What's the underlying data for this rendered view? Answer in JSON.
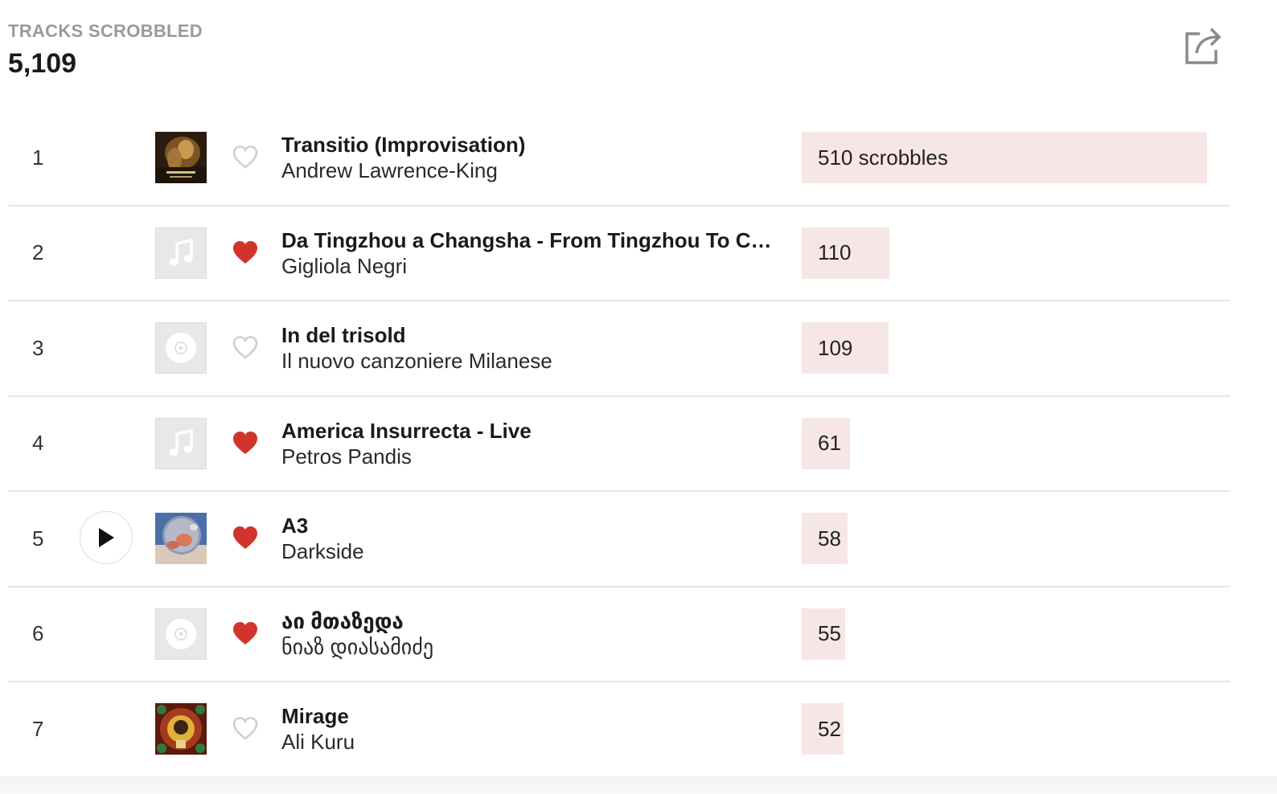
{
  "stats": {
    "label": "TRACKS SCROBBLED",
    "value": "5,109"
  },
  "share_icon": "share-icon",
  "colors": {
    "love_active": "#d0342c",
    "love_inactive": "#cfcfcf",
    "bar_fill": "#f7e6e6"
  },
  "tracks": [
    {
      "rank": "1",
      "title": "Transitio (Improvisation)",
      "artist": "Andrew Lawrence-King",
      "scrobbles": "510 scrobbles",
      "count": 510,
      "loved": false,
      "cover": "album-art",
      "cover_style": "gold-dark"
    },
    {
      "rank": "2",
      "title": "Da Tingzhou a Changsha - From Tingzhou To Cha...",
      "artist": "Gigliola Negri",
      "scrobbles": "110",
      "count": 110,
      "loved": true,
      "cover": "music-note-placeholder"
    },
    {
      "rank": "3",
      "title": "In del trisold",
      "artist": "Il nuovo canzoniere Milanese",
      "scrobbles": "109",
      "count": 109,
      "loved": false,
      "cover": "disc-placeholder"
    },
    {
      "rank": "4",
      "title": "America Insurrecta - Live",
      "artist": "Petros Pandis",
      "scrobbles": "61",
      "count": 61,
      "loved": true,
      "cover": "music-note-placeholder"
    },
    {
      "rank": "5",
      "title": "A3",
      "artist": "Darkside",
      "scrobbles": "58",
      "count": 58,
      "loved": true,
      "cover": "album-art",
      "cover_style": "moon-blue",
      "show_play": true
    },
    {
      "rank": "6",
      "title": "აი მთაზედა",
      "artist": "ნიაზ დიასამიძე",
      "scrobbles": "55",
      "count": 55,
      "loved": true,
      "cover": "disc-placeholder"
    },
    {
      "rank": "7",
      "title": "Mirage",
      "artist": "Ali Kuru",
      "scrobbles": "52",
      "count": 52,
      "loved": false,
      "cover": "album-art",
      "cover_style": "ornate-red"
    }
  ]
}
